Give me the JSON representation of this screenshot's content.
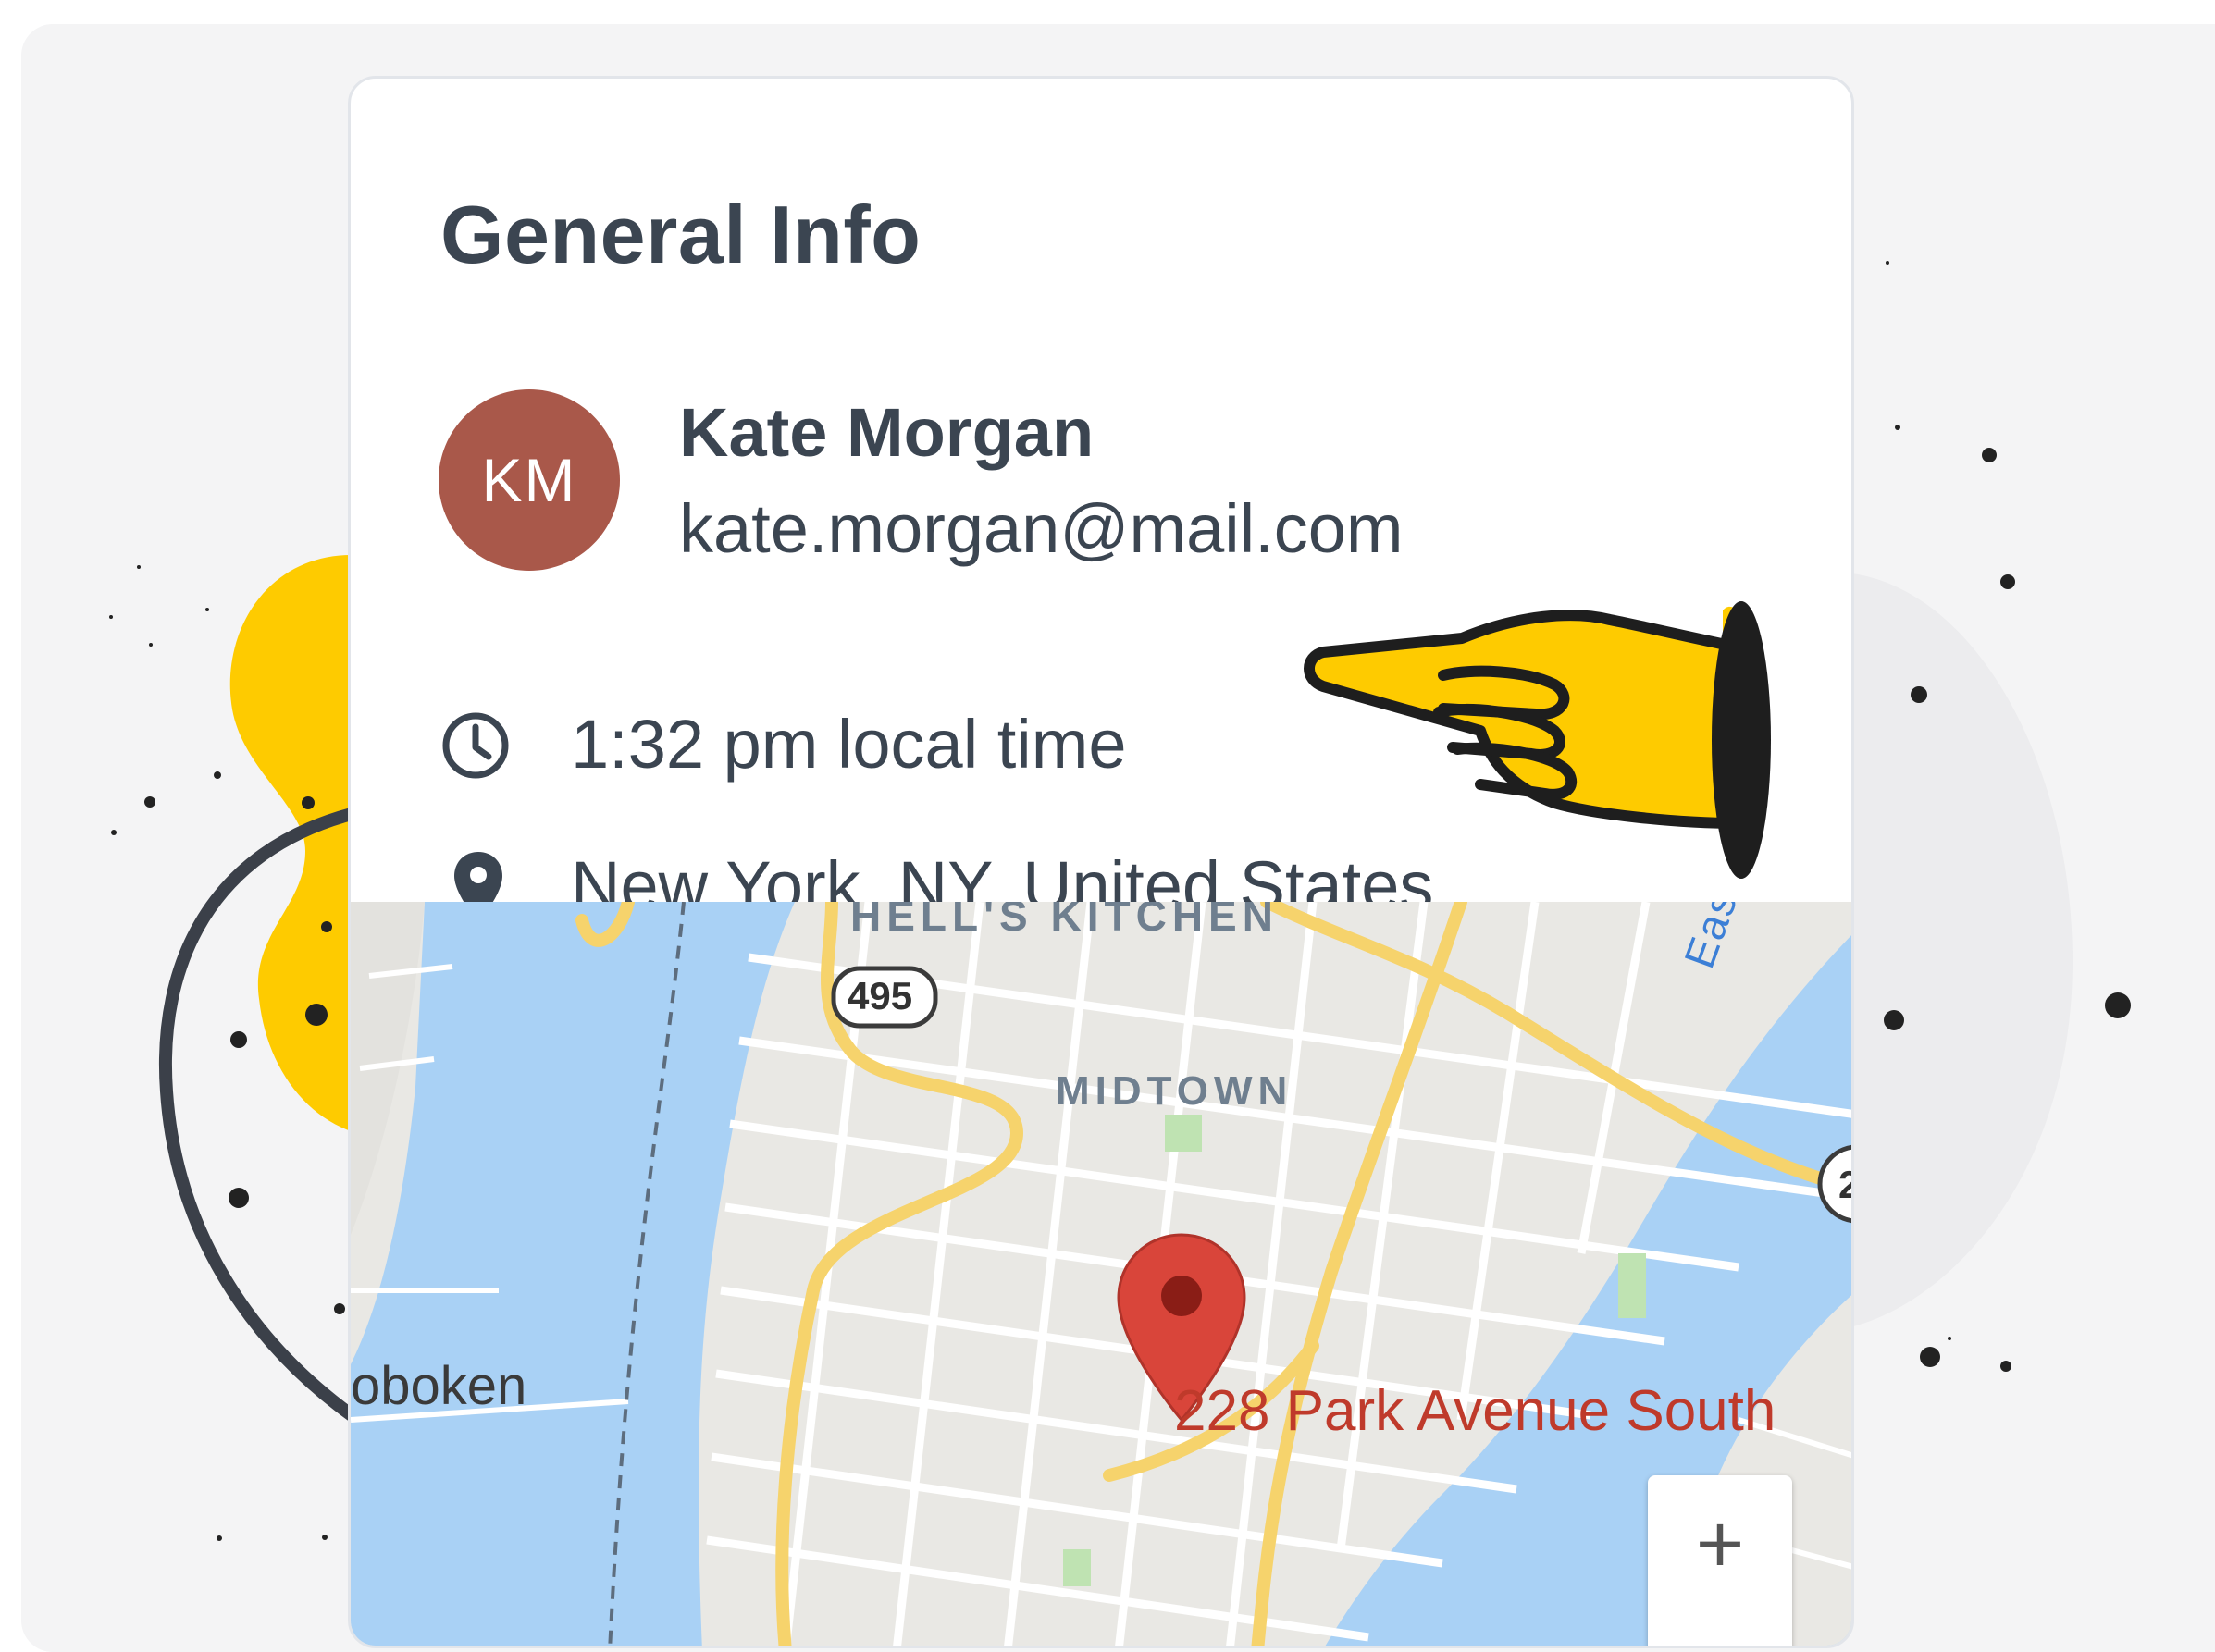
{
  "card": {
    "title": "General Info"
  },
  "contact": {
    "initials": "KM",
    "name": "Kate Morgan",
    "email": "kate.morgan@mail.com",
    "avatar_color": "#a9584a"
  },
  "details": {
    "local_time": "1:32 pm local time",
    "location": "New York, NY, United States"
  },
  "map": {
    "labels": {
      "hells_kitchen": "HELL'S KITCHEN",
      "midtown": "MIDTOWN",
      "hoboken": "oboken",
      "east_river": "East Ri",
      "highway": "495",
      "highway_partial": "2"
    },
    "marker_address": "228 Park Avenue South",
    "zoom_in_label": "+"
  },
  "colors": {
    "accent_yellow": "#fecb00",
    "marker_red": "#d9453a",
    "text_dark": "#3b4551",
    "water": "#a9d1f5",
    "road_yellow": "#f6d36c"
  }
}
